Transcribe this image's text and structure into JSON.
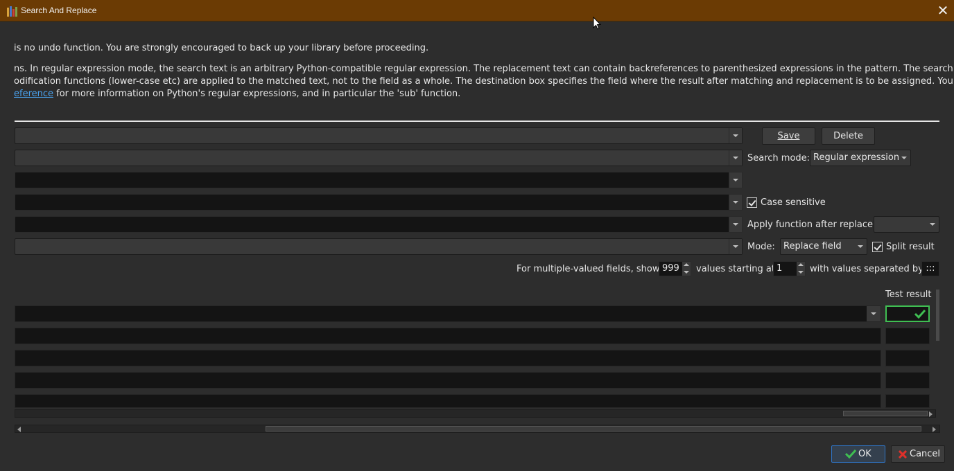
{
  "window": {
    "title": "Search And Replace",
    "close_glyph": "✕",
    "titlebar_color": "#6b3b04"
  },
  "info": {
    "line1": "is no undo function. You are strongly encouraged to back up your library before proceeding.",
    "line2": "ns. In regular expression mode, the search text is an arbitrary Python-compatible regular expression. The replacement text can contain backreferences to parenthesized expressions in the pattern. The search is not",
    "line3": "odification functions (lower-case etc) are applied to the matched text, not to the field as a whole. The destination box specifies the field where the result after matching and replacement is to be assigned. You can",
    "line4_link": "eference",
    "line4_rest": " for more information on Python's regular expressions, and in particular the 'sub' function."
  },
  "buttons": {
    "save": "Save",
    "delete": "Delete",
    "ok": "OK",
    "cancel": "Cancel"
  },
  "search_mode": {
    "label": "Search mode:",
    "value": "Regular expression"
  },
  "case_sensitive": {
    "label": "Case sensitive",
    "checked": true
  },
  "apply_function": {
    "label": "Apply function after replace:",
    "value": ""
  },
  "mode": {
    "label": "Mode:",
    "value": "Replace field"
  },
  "split_result": {
    "label": "Split result",
    "checked": true
  },
  "multi": {
    "label_show": "For multiple-valued fields, show",
    "show_value": "999",
    "label_start": "values starting at",
    "start_value": "1",
    "label_sep": "with values separated by",
    "sep_value": ":::"
  },
  "test": {
    "header": "Test result",
    "rows": 5
  },
  "colors": {
    "accent_green": "#3fbf52",
    "ok_border": "#2f75c7",
    "link": "#4aa3f0",
    "cancel_x": "#e0302a"
  }
}
